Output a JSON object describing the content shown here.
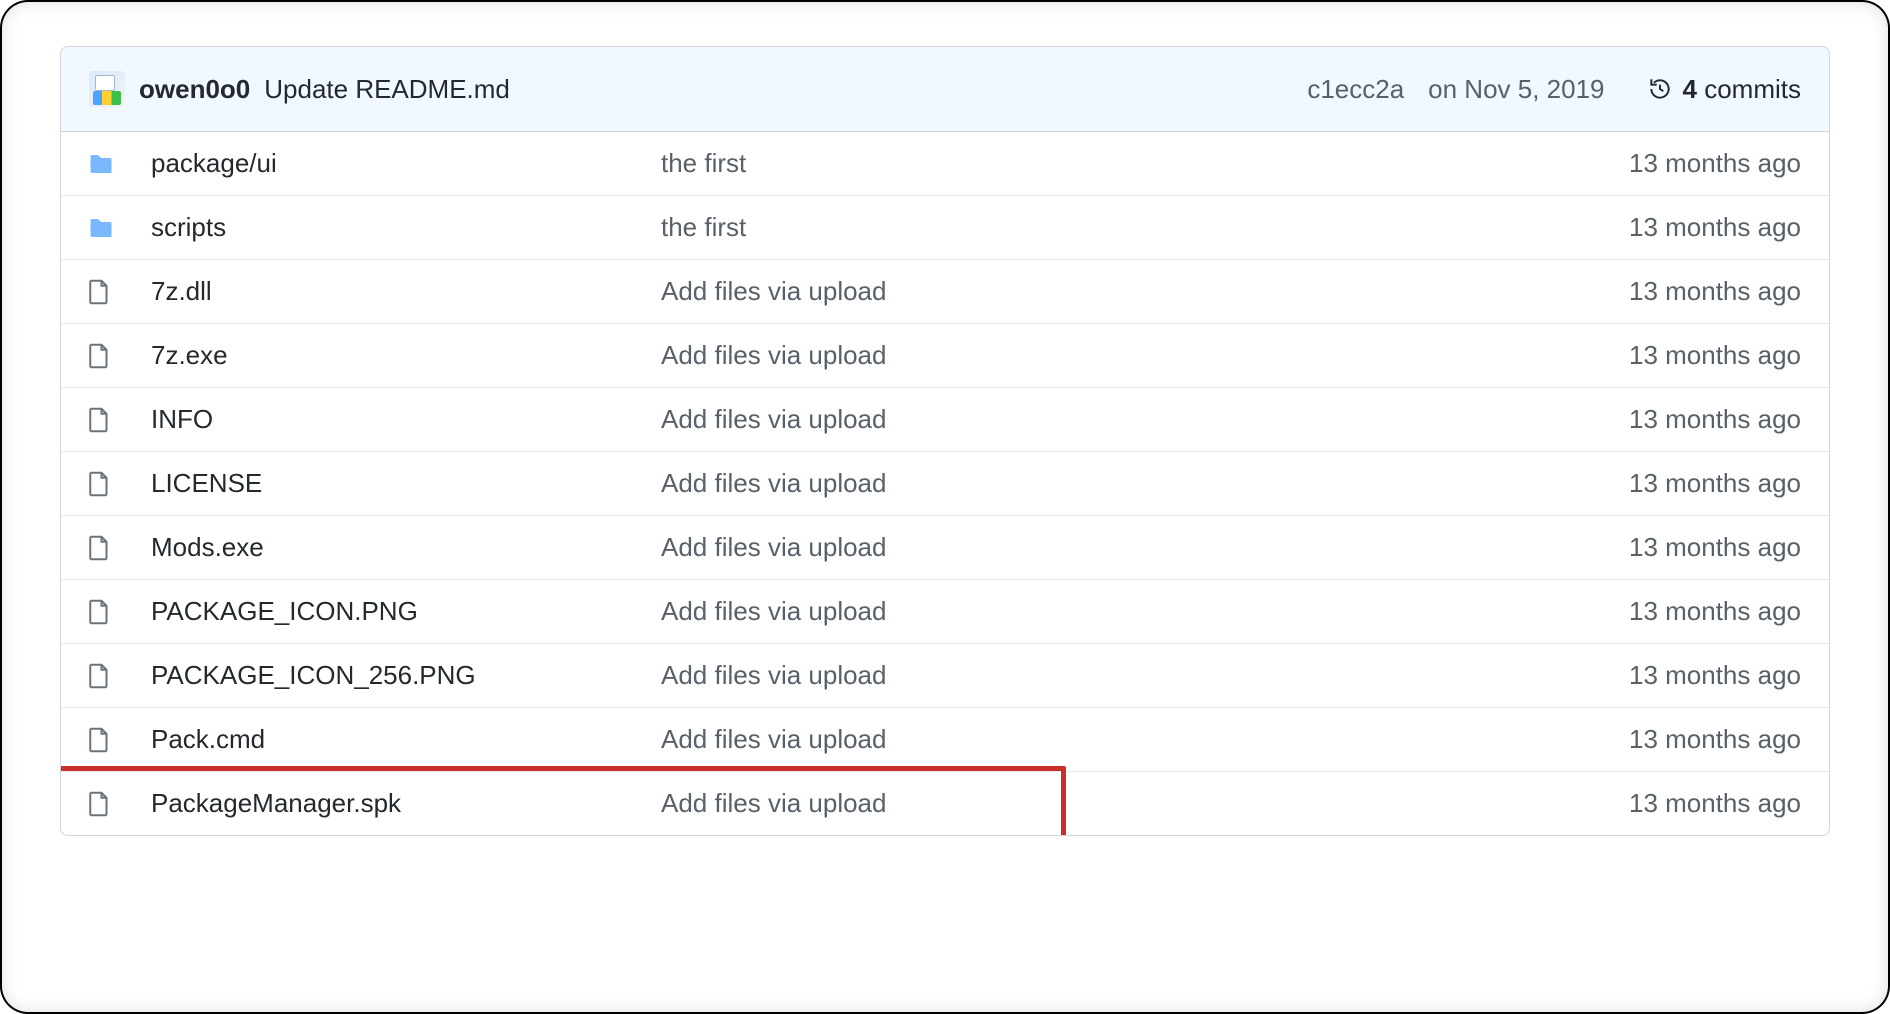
{
  "header": {
    "author": "owen0o0",
    "commit_message": "Update README.md",
    "sha": "c1ecc2a",
    "date": "on Nov 5, 2019",
    "commits_count": "4",
    "commits_word": "commits"
  },
  "rows": [
    {
      "type": "folder",
      "name": "package/ui",
      "msg": "the first",
      "time": "13 months ago"
    },
    {
      "type": "folder",
      "name": "scripts",
      "msg": "the first",
      "time": "13 months ago"
    },
    {
      "type": "file",
      "name": "7z.dll",
      "msg": "Add files via upload",
      "time": "13 months ago"
    },
    {
      "type": "file",
      "name": "7z.exe",
      "msg": "Add files via upload",
      "time": "13 months ago"
    },
    {
      "type": "file",
      "name": "INFO",
      "msg": "Add files via upload",
      "time": "13 months ago"
    },
    {
      "type": "file",
      "name": "LICENSE",
      "msg": "Add files via upload",
      "time": "13 months ago"
    },
    {
      "type": "file",
      "name": "Mods.exe",
      "msg": "Add files via upload",
      "time": "13 months ago"
    },
    {
      "type": "file",
      "name": "PACKAGE_ICON.PNG",
      "msg": "Add files via upload",
      "time": "13 months ago"
    },
    {
      "type": "file",
      "name": "PACKAGE_ICON_256.PNG",
      "msg": "Add files via upload",
      "time": "13 months ago"
    },
    {
      "type": "file",
      "name": "Pack.cmd",
      "msg": "Add files via upload",
      "time": "13 months ago"
    },
    {
      "type": "file",
      "name": "PackageManager.spk",
      "msg": "Add files via upload",
      "time": "13 months ago",
      "highlighted": true
    }
  ]
}
